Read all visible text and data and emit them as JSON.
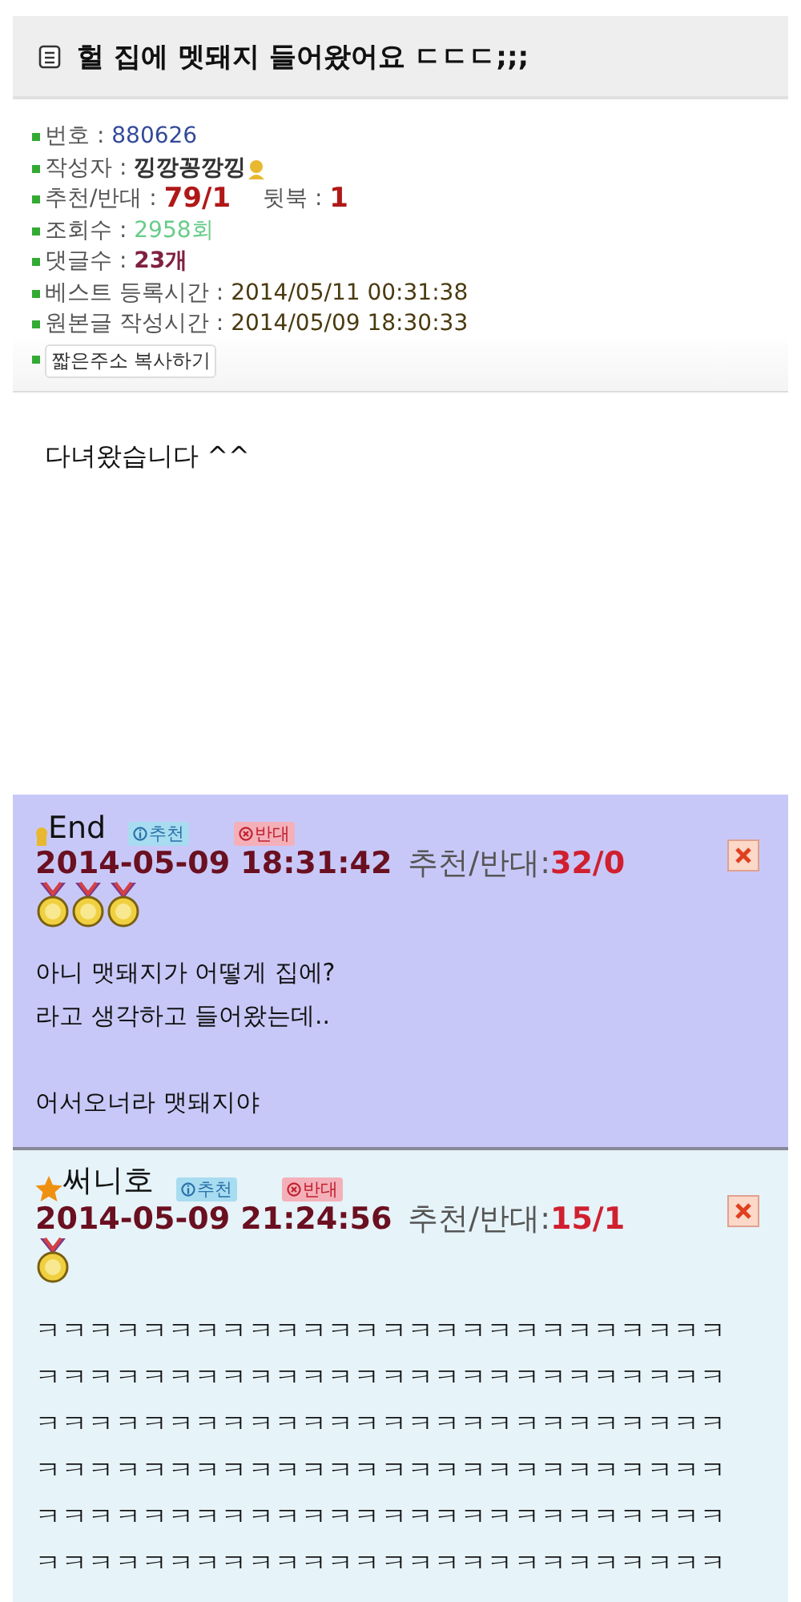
{
  "post": {
    "title": "헐 집에 멧돼지 들어왔어요 ㄷㄷㄷ;;;",
    "info": [
      {
        "kind": "number",
        "label": "번호 : ",
        "value": "880626"
      },
      {
        "kind": "author",
        "label": "작성자 : ",
        "value": "낑깡꽁깡낑"
      },
      {
        "kind": "votes",
        "label": "추천/반대 : ",
        "value": "79/1",
        "extra_label": "뒷북 : ",
        "extra_value": "1"
      },
      {
        "kind": "views",
        "label": "조회수 : ",
        "value": "2958회"
      },
      {
        "kind": "comments",
        "label": "댓글수 : ",
        "value": "23개"
      },
      {
        "kind": "time",
        "label": "베스트 등록시간 : ",
        "value": "2014/05/11 00:31:38"
      },
      {
        "kind": "time",
        "label": "원본글 작성시간 : ",
        "value": "2014/05/09 18:30:33"
      }
    ],
    "copy_button": "짧은주소 복사하기",
    "body": "다녀왔습니다 ^^"
  },
  "comments": [
    {
      "color": "#c8c8f8",
      "author_icon": {
        "kind": "badge"
      },
      "author": "End",
      "recommend": "추천",
      "oppose": "반대",
      "time": "2014-05-09 18:31:42",
      "vote_label": "추천/반대:",
      "votes": "32/0",
      "medals": [
        {
          "kind": "gold"
        },
        {
          "kind": "gold"
        },
        {
          "kind": "gold"
        }
      ],
      "paragraphs": [
        [
          "아니 맷돼지가 어떻게 집에?",
          "라고 생각하고 들어왔는데.."
        ],
        [
          "어서오너라 맷돼지야"
        ]
      ]
    },
    {
      "color": "#e6f3f8",
      "author_icon": {
        "kind": "star"
      },
      "author": "써니호",
      "recommend": "추천",
      "oppose": "반대",
      "time": "2014-05-09 21:24:56",
      "vote_label": "추천/반대:",
      "votes": "15/1",
      "medals": [
        {
          "kind": "gold"
        }
      ],
      "paragraphs": [
        [
          "ㅋㅋㅋㅋㅋㅋㅋㅋㅋㅋㅋㅋㅋㅋㅋㅋㅋㅋㅋㅋㅋㅋㅋㅋㅋㅋ",
          "ㅋㅋㅋㅋㅋㅋㅋㅋㅋㅋㅋㅋㅋㅋㅋㅋㅋㅋㅋㅋㅋㅋㅋㅋㅋㅋ",
          "ㅋㅋㅋㅋㅋㅋㅋㅋㅋㅋㅋㅋㅋㅋㅋㅋㅋㅋㅋㅋㅋㅋㅋㅋㅋㅋ",
          "ㅋㅋㅋㅋㅋㅋㅋㅋㅋㅋㅋㅋㅋㅋㅋㅋㅋㅋㅋㅋㅋㅋㅋㅋㅋㅋ",
          "ㅋㅋㅋㅋㅋㅋㅋㅋㅋㅋㅋㅋㅋㅋㅋㅋㅋㅋㅋㅋㅋㅋㅋㅋㅋㅋ",
          "ㅋㅋㅋㅋㅋㅋㅋㅋㅋㅋㅋㅋㅋㅋㅋㅋㅋㅋㅋㅋㅋㅋㅋㅋㅋㅋ"
        ]
      ]
    }
  ]
}
